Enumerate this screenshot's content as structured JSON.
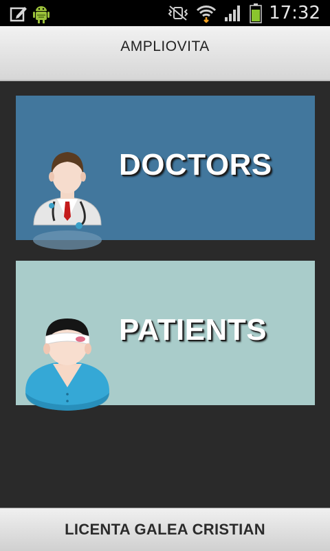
{
  "status_bar": {
    "time": "17:32",
    "icons": [
      "edit-note-icon",
      "android-debug-icon",
      "vibrate-mute-icon",
      "wifi-icon",
      "signal-icon",
      "battery-icon"
    ]
  },
  "header": {
    "title": "AMPLIOVITA"
  },
  "tiles": [
    {
      "label": "DOCTORS",
      "icon": "doctor-icon",
      "bg": "#42779d"
    },
    {
      "label": "PATIENTS",
      "icon": "patient-icon",
      "bg": "#a9ccca"
    }
  ],
  "footer": {
    "text": "LICENTA GALEA CRISTIAN"
  }
}
